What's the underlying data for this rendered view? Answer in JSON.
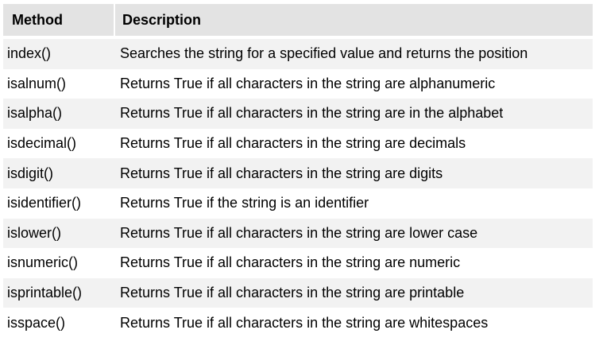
{
  "table": {
    "headers": {
      "method": "Method",
      "description": "Description"
    },
    "rows": [
      {
        "method": "index()",
        "description": "Searches the string for a specified value and returns the position"
      },
      {
        "method": "isalnum()",
        "description": "Returns True if all characters in the string are alphanumeric"
      },
      {
        "method": "isalpha()",
        "description": "Returns True if all characters in the string are in the alphabet"
      },
      {
        "method": "isdecimal()",
        "description": "Returns True if all characters in the string are decimals"
      },
      {
        "method": "isdigit()",
        "description": "Returns True if all characters in the string are digits"
      },
      {
        "method": "isidentifier()",
        "description": "Returns True if the string is an identifier"
      },
      {
        "method": "islower()",
        "description": "Returns True if all characters in the string are lower case"
      },
      {
        "method": "isnumeric()",
        "description": "Returns True if all characters in the string are numeric"
      },
      {
        "method": "isprintable()",
        "description": "Returns True if all characters in the string are printable"
      },
      {
        "method": "isspace()",
        "description": "Returns True if all characters in the string are whitespaces"
      }
    ]
  },
  "colors": {
    "header_bg": "#e3e3e3",
    "alt_row_bg": "#f2f2f2",
    "row_bg": "#ffffff"
  }
}
